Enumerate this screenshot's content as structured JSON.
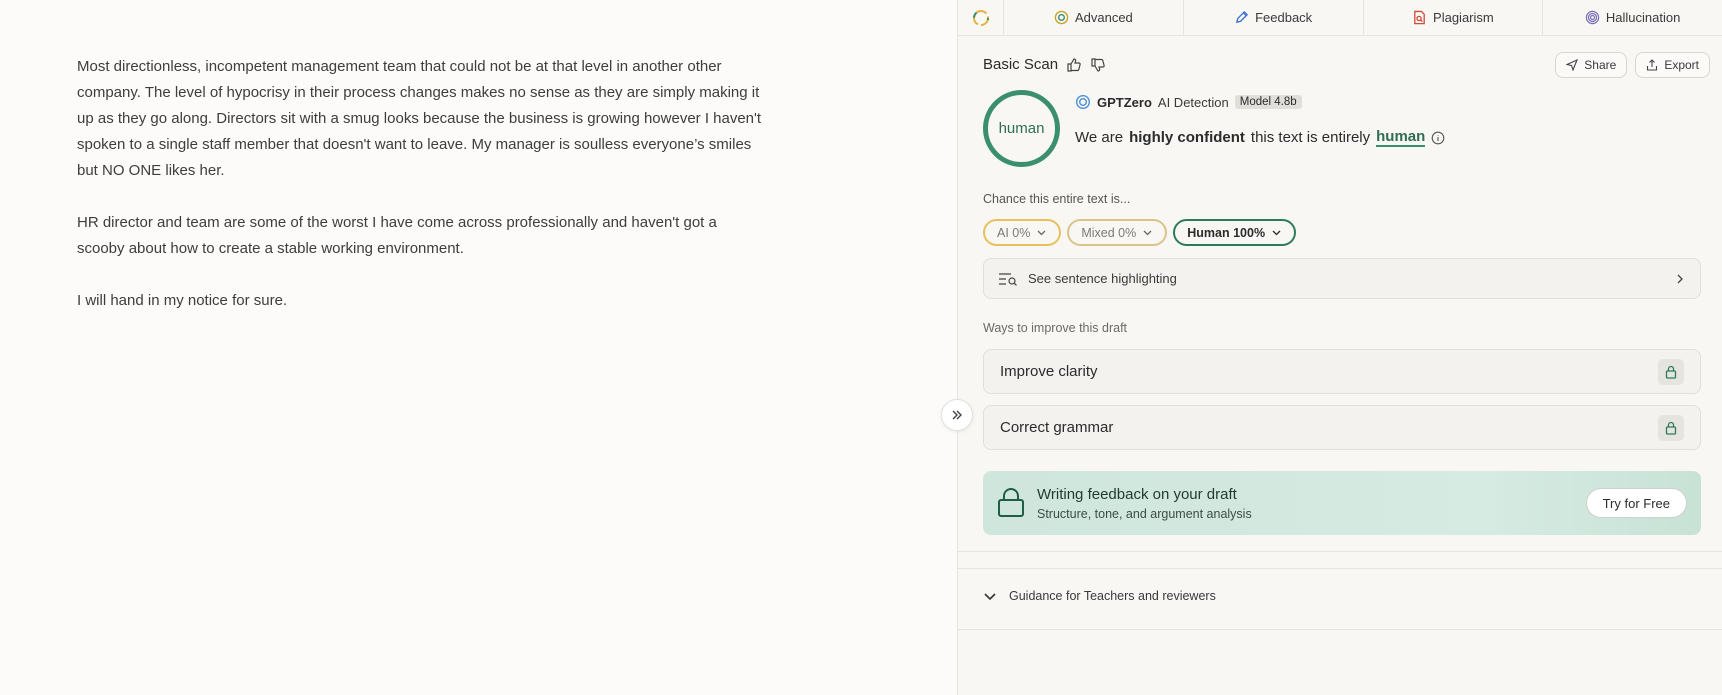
{
  "editor": {
    "paragraphs": [
      "Most directionless, incompetent management team that could not be at that level in another other company. The level of hypocrisy in their process changes makes no sense as they are simply making it up as they go along. Directors sit with a smug looks because the business is growing however I haven't spoken to a single staff member that doesn't want to leave. My manager is soulless everyone’s smiles but NO ONE likes her.",
      "HR director and team are some of the worst I have come across professionally and haven't got a scooby about how to create a stable working environment.",
      "I will hand in my notice for sure."
    ]
  },
  "tabs": [
    {
      "label": "Advanced",
      "icon": "advanced-icon"
    },
    {
      "label": "Feedback",
      "icon": "pen-icon"
    },
    {
      "label": "Plagiarism",
      "icon": "document-search-icon"
    },
    {
      "label": "Hallucination",
      "icon": "spiral-icon"
    }
  ],
  "scan": {
    "title": "Basic Scan",
    "share_label": "Share",
    "export_label": "Export",
    "gauge_label": "human",
    "detector_name": "GPTZero",
    "detector_suffix": "AI Detection",
    "model_badge": "Model 4.8b",
    "verdict_prefix": "We are",
    "verdict_confidence": "highly confident",
    "verdict_middle": "this text is entirely",
    "verdict_result": "human"
  },
  "chance": {
    "label": "Chance this entire text is...",
    "pills": [
      {
        "label": "AI 0%",
        "value": 0
      },
      {
        "label": "Mixed 0%",
        "value": 0
      },
      {
        "label": "Human 100%",
        "value": 100
      }
    ]
  },
  "highlighting": {
    "label": "See sentence highlighting"
  },
  "improve": {
    "label": "Ways to improve this draft",
    "items": [
      "Improve clarity",
      "Correct grammar"
    ]
  },
  "feedback_card": {
    "title": "Writing feedback on your draft",
    "subtitle": "Structure, tone, and argument analysis",
    "button": "Try for Free"
  },
  "guidance": {
    "label": "Guidance for Teachers and reviewers"
  },
  "colors": {
    "accent_green": "#3b8f6e",
    "ai_yellow": "#e8c05c",
    "mixed_tan": "#d9c488"
  }
}
